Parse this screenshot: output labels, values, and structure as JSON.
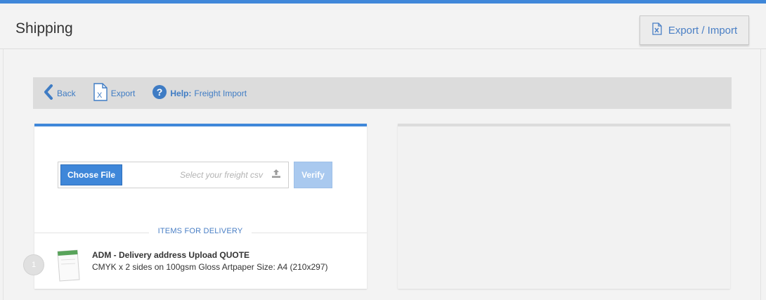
{
  "header": {
    "title": "Shipping",
    "export_import_label": "Export / Import"
  },
  "toolbar": {
    "back_label": "Back",
    "export_label": "Export",
    "help_prefix": "Help:",
    "help_label": "Freight Import"
  },
  "upload": {
    "choose_file_label": "Choose File",
    "placeholder": "Select your freight csv",
    "verify_label": "Verify"
  },
  "items_section": {
    "heading": "ITEMS FOR DELIVERY",
    "items": [
      {
        "number": "1",
        "title": "ADM - Delivery address Upload QUOTE",
        "description": "CMYK x 2 sides on 100gsm Gloss Artpaper Size: A4 (210x297)"
      }
    ]
  },
  "colors": {
    "accent": "#3f87d9",
    "link": "#3f7cc4",
    "verify_disabled": "#a9c9ef"
  },
  "icons": {
    "export_import": "excel-file-icon",
    "back": "chevron-left-icon",
    "export": "excel-file-icon",
    "help": "question-circle-icon",
    "upload": "upload-icon"
  }
}
